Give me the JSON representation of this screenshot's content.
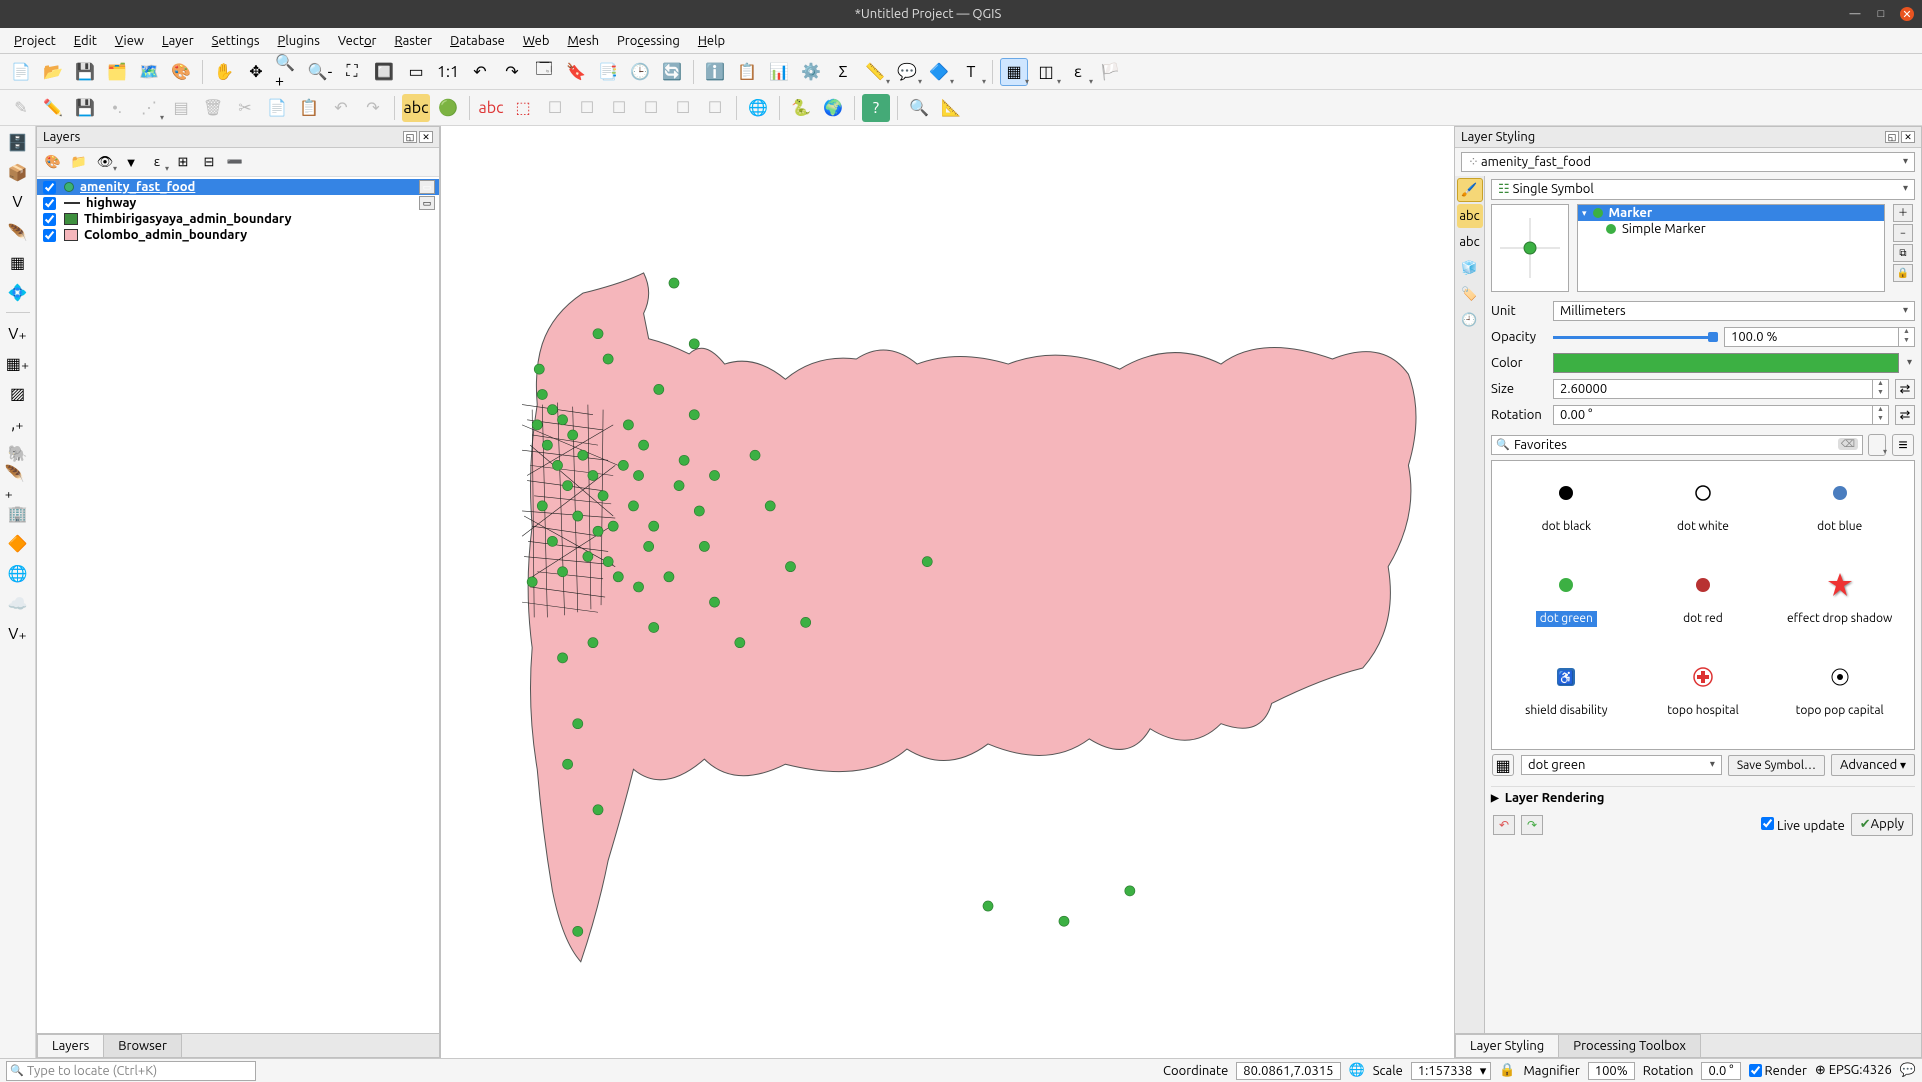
{
  "window": {
    "title": "*Untitled Project — QGIS"
  },
  "menu": [
    "Project",
    "Edit",
    "View",
    "Layer",
    "Settings",
    "Plugins",
    "Vector",
    "Raster",
    "Database",
    "Web",
    "Mesh",
    "Processing",
    "Help"
  ],
  "layers_panel": {
    "title": "Layers",
    "tabs": {
      "layers": "Layers",
      "browser": "Browser"
    },
    "items": [
      {
        "name": "amenity_fast_food",
        "type": "point",
        "checked": true,
        "selected": true
      },
      {
        "name": "highway",
        "type": "line",
        "checked": true,
        "selected": false
      },
      {
        "name": "Thimbirigasyaya_admin_boundary",
        "type": "poly1",
        "checked": true,
        "selected": false
      },
      {
        "name": "Colombo_admin_boundary",
        "type": "poly2",
        "checked": true,
        "selected": false
      }
    ]
  },
  "styling": {
    "title": "Layer Styling",
    "target_layer": "amenity_fast_food",
    "renderer": "Single Symbol",
    "tree": {
      "marker": "Marker",
      "simple_marker": "Simple Marker"
    },
    "unit_label": "Unit",
    "unit_value": "Millimeters",
    "opacity_label": "Opacity",
    "opacity_value": "100.0 %",
    "opacity_pct": 100,
    "color_label": "Color",
    "color_hex": "#3cb043",
    "size_label": "Size",
    "size_value": "2.60000",
    "rotation_label": "Rotation",
    "rotation_value": "0.00 °",
    "favorites_label": "Favorites",
    "selected_symbol": "dot green",
    "symbols": [
      {
        "label": "dot  black"
      },
      {
        "label": "dot  white"
      },
      {
        "label": "dot blue"
      },
      {
        "label": "dot green",
        "selected": true
      },
      {
        "label": "dot red"
      },
      {
        "label": "effect drop shadow"
      },
      {
        "label": "shield disability"
      },
      {
        "label": "topo hospital"
      },
      {
        "label": "topo pop capital"
      }
    ],
    "footer_symbol": "dot green",
    "save_symbol": "Save Symbol…",
    "advanced": "Advanced",
    "layer_rendering": "Layer Rendering",
    "live_update": "Live update",
    "apply": "Apply",
    "bottom_tabs": {
      "styling": "Layer Styling",
      "toolbox": "Processing Toolbox"
    }
  },
  "status": {
    "locate_placeholder": "Type to locate (Ctrl+K)",
    "coord_label": "Coordinate",
    "coord_value": "80.0861,7.0315",
    "scale_label": "Scale",
    "scale_value": "1:157338",
    "magnifier_label": "Magnifier",
    "magnifier_value": "100%",
    "rotation_label": "Rotation",
    "rotation_value": "0.0 °",
    "render_label": "Render",
    "crs": "EPSG:4326"
  }
}
